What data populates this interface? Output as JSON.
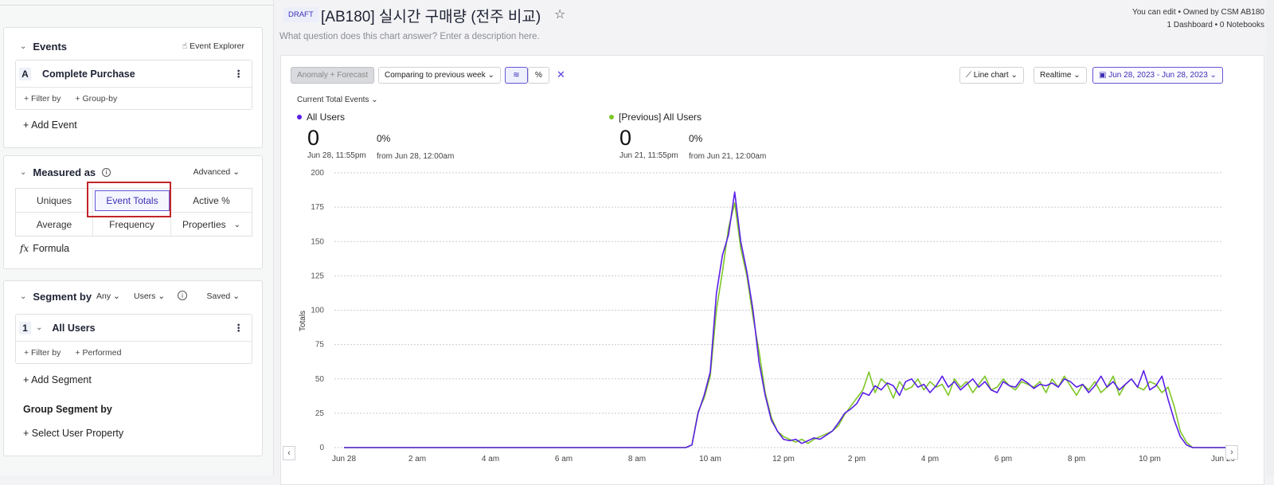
{
  "sidebar": {
    "events": {
      "header": "Events",
      "explorer_label": "Event Explorer",
      "items": [
        {
          "badge": "A",
          "name": "Complete Purchase",
          "filter_label": "+ Filter by",
          "group_label": "+ Group-by"
        }
      ],
      "add_label": "+ Add Event"
    },
    "measured": {
      "header": "Measured as",
      "advanced_label": "Advanced",
      "options": [
        "Uniques",
        "Event Totals",
        "Active %",
        "Average",
        "Frequency",
        "Properties"
      ],
      "selected": "Event Totals",
      "formula_icon": "fx",
      "formula_label": "Formula"
    },
    "segment": {
      "header": "Segment by",
      "any_label": "Any",
      "users_label": "Users",
      "saved_label": "Saved",
      "items": [
        {
          "badge": "1",
          "name": "All Users",
          "filter_label": "+ Filter by",
          "performed_label": "+ Performed"
        }
      ],
      "add_label": "+ Add Segment",
      "group_header": "Group Segment by",
      "select_property_label": "+ Select User Property"
    }
  },
  "header": {
    "draft_badge": "DRAFT",
    "title": "[AB180] 실시간 구매량 (전주 비교)",
    "description_placeholder": "What question does this chart answer? Enter a description here.",
    "owner_line1": "You can edit • Owned by CSM AB180",
    "owner_line2": "1 Dashboard • 0 Notebooks"
  },
  "toolbar": {
    "anomaly_label": "Anomaly + Forecast",
    "compare_label": "Comparing to previous week",
    "percent_label": "%",
    "close_label": "✕",
    "chart_type_label": "Line chart",
    "realtime_label": "Realtime",
    "date_range_label": "Jun 28, 2023 - Jun 28, 2023"
  },
  "summary": {
    "metric_selector": "Current Total Events",
    "series": [
      {
        "name": "All Users",
        "value": "0",
        "time": "Jun 28, 11:55pm",
        "change": "0%",
        "from": "from Jun 28, 12:00am",
        "color": "#5a1ee6"
      },
      {
        "name": "[Previous] All Users",
        "value": "0",
        "time": "Jun 21, 11:55pm",
        "change": "0%",
        "from": "from Jun 21, 12:00am",
        "color": "#7ec628"
      }
    ]
  },
  "chart_data": {
    "type": "line",
    "title": "",
    "xlabel": "",
    "ylabel": "Totals",
    "ylim": [
      0,
      200
    ],
    "yticks": [
      0,
      25,
      50,
      75,
      100,
      125,
      150,
      175,
      200
    ],
    "xlim_hours": [
      0,
      24
    ],
    "xtick_hours": [
      0,
      2,
      4,
      6,
      8,
      10,
      12,
      14,
      16,
      18,
      20,
      22,
      24
    ],
    "xtick_labels": [
      "Jun 28",
      "2 am",
      "4 am",
      "6 am",
      "8 am",
      "10 am",
      "12 pm",
      "2 pm",
      "4 pm",
      "6 pm",
      "8 pm",
      "10 pm",
      "Jun 29"
    ],
    "grid": true,
    "x_interval_minutes": 10,
    "series": [
      {
        "name": "All Users",
        "color": "#5a1ee6",
        "values": [
          0,
          0,
          0,
          0,
          0,
          0,
          0,
          0,
          0,
          0,
          0,
          0,
          0,
          0,
          0,
          0,
          0,
          0,
          0,
          0,
          0,
          0,
          0,
          0,
          0,
          0,
          0,
          0,
          0,
          0,
          0,
          0,
          0,
          0,
          0,
          0,
          0,
          0,
          0,
          0,
          0,
          0,
          0,
          0,
          0,
          0,
          0,
          0,
          0,
          0,
          0,
          0,
          0,
          0,
          0,
          0,
          0,
          2,
          25,
          38,
          55,
          112,
          140,
          155,
          186,
          150,
          128,
          100,
          62,
          38,
          20,
          12,
          6,
          5,
          6,
          3,
          5,
          7,
          6,
          9,
          12,
          18,
          25,
          28,
          32,
          40,
          38,
          45,
          42,
          47,
          45,
          38,
          48,
          50,
          44,
          46,
          40,
          45,
          52,
          44,
          48,
          42,
          46,
          50,
          44,
          48,
          42,
          40,
          48,
          45,
          44,
          50,
          47,
          43,
          46,
          45,
          47,
          44,
          50,
          48,
          44,
          46,
          40,
          45,
          52,
          44,
          48,
          42,
          46,
          50,
          44,
          56,
          42,
          45,
          52,
          35,
          20,
          8,
          2,
          0,
          0,
          0,
          0,
          0,
          0,
          0
        ]
      },
      {
        "name": "[Previous] All Users",
        "color": "#7ec628",
        "values": [
          0,
          0,
          0,
          0,
          0,
          0,
          0,
          0,
          0,
          0,
          0,
          0,
          0,
          0,
          0,
          0,
          0,
          0,
          0,
          0,
          0,
          0,
          0,
          0,
          0,
          0,
          0,
          0,
          0,
          0,
          0,
          0,
          0,
          0,
          0,
          0,
          0,
          0,
          0,
          0,
          0,
          0,
          0,
          0,
          0,
          0,
          0,
          0,
          0,
          0,
          0,
          0,
          0,
          0,
          0,
          0,
          0,
          2,
          26,
          36,
          52,
          100,
          128,
          160,
          178,
          145,
          125,
          95,
          70,
          40,
          22,
          12,
          8,
          6,
          4,
          6,
          3,
          6,
          8,
          10,
          12,
          16,
          24,
          30,
          36,
          42,
          55,
          40,
          50,
          46,
          36,
          48,
          42,
          44,
          50,
          42,
          48,
          44,
          46,
          38,
          50,
          44,
          48,
          40,
          46,
          52,
          42,
          44,
          50,
          45,
          42,
          48,
          46,
          44,
          48,
          40,
          50,
          44,
          52,
          45,
          38,
          46,
          42,
          48,
          40,
          44,
          52,
          38,
          46,
          50,
          44,
          42,
          48,
          46,
          40,
          44,
          30,
          12,
          4,
          0,
          0,
          0,
          0,
          0,
          0,
          0
        ]
      }
    ]
  }
}
